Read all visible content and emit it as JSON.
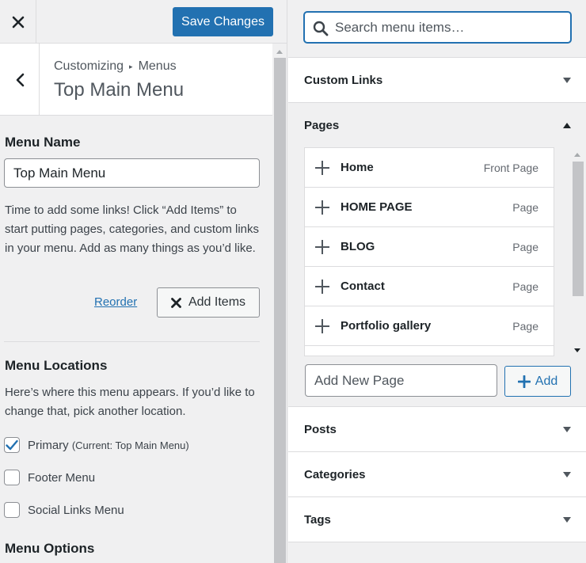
{
  "toolbar": {
    "close_icon": "close-icon",
    "save_label": "Save Changes"
  },
  "header": {
    "breadcrumb_root": "Customizing",
    "breadcrumb_separator": "▸",
    "breadcrumb_current": "Menus",
    "title": "Top Main Menu"
  },
  "menu_name": {
    "label": "Menu Name",
    "value": "Top Main Menu",
    "help": "Time to add some links! Click “Add Items” to start putting pages, categories, and custom links in your menu. Add as many things as you’d like.",
    "reorder_label": "Reorder",
    "add_items_label": "Add Items"
  },
  "locations": {
    "title": "Menu Locations",
    "help": "Here’s where this menu appears. If you’d like to change that, pick another location.",
    "items": [
      {
        "label": "Primary",
        "sublabel": "(Current: Top Main Menu)",
        "checked": true
      },
      {
        "label": "Footer Menu",
        "sublabel": "",
        "checked": false
      },
      {
        "label": "Social Links Menu",
        "sublabel": "",
        "checked": false
      }
    ]
  },
  "options": {
    "title": "Menu Options"
  },
  "search": {
    "placeholder": "Search menu items…"
  },
  "sections": {
    "custom_links": "Custom Links",
    "pages": "Pages",
    "posts": "Posts",
    "categories": "Categories",
    "tags": "Tags"
  },
  "pages": {
    "items": [
      {
        "title": "Home",
        "type": "Front Page"
      },
      {
        "title": "HOME PAGE",
        "type": "Page"
      },
      {
        "title": "BLOG",
        "type": "Page"
      },
      {
        "title": "Contact",
        "type": "Page"
      },
      {
        "title": "Portfolio gallery",
        "type": "Page"
      }
    ],
    "new_placeholder": "Add New Page",
    "add_label": "Add"
  },
  "colors": {
    "accent": "#2271b1",
    "panel_bg": "#f0f0f1",
    "border": "#dcdcde"
  }
}
